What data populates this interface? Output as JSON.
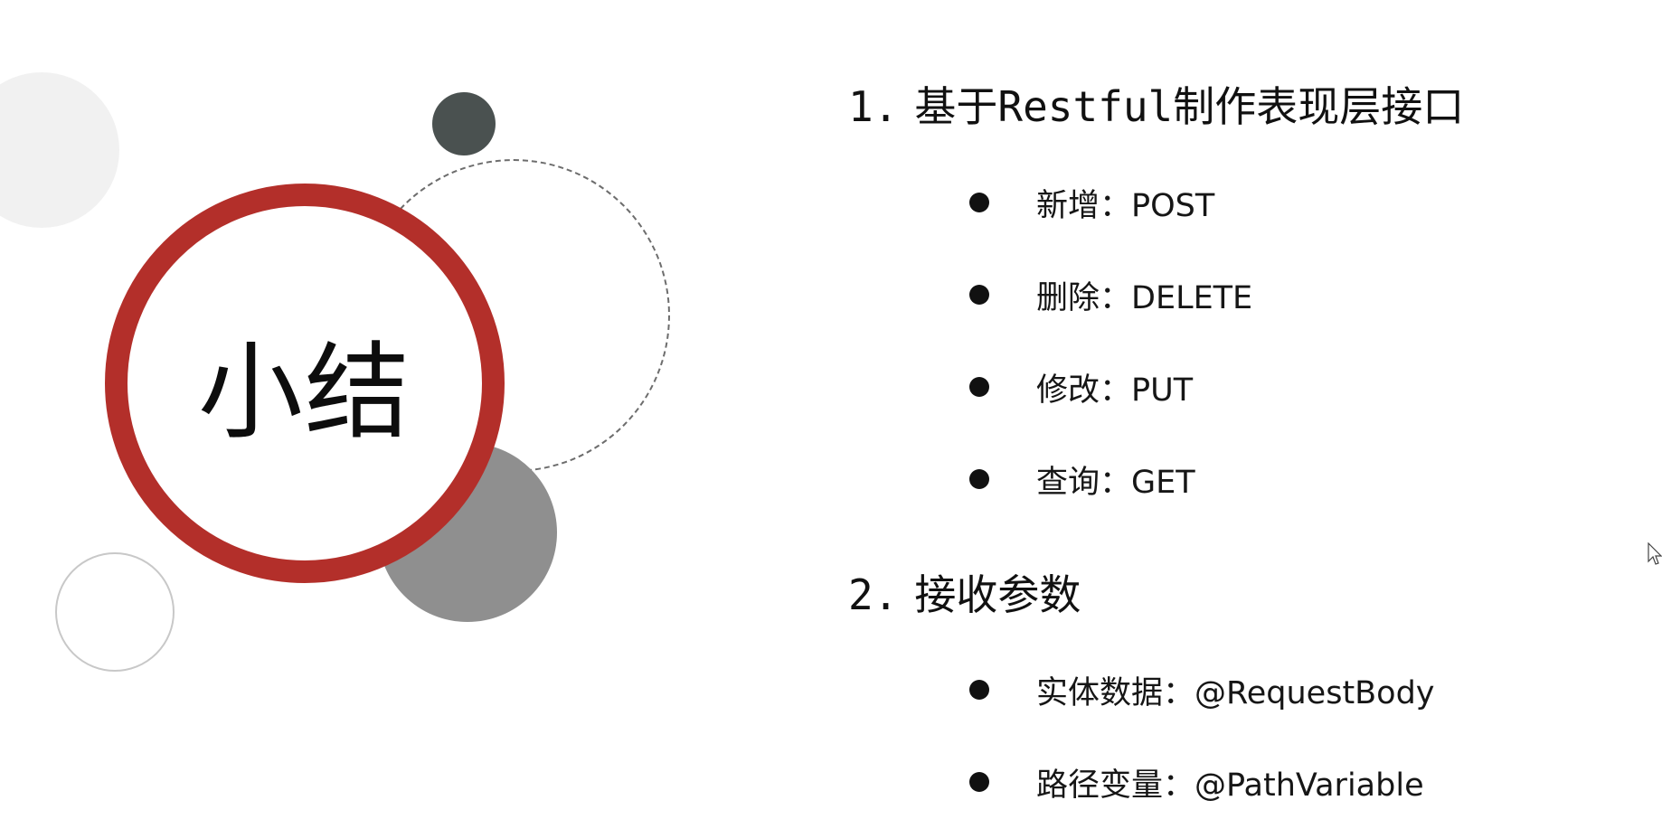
{
  "slide": {
    "title": "小结"
  },
  "sections": [
    {
      "number": "1.",
      "heading": "基于Restful制作表现层接口",
      "items": [
        {
          "label": "新增：POST"
        },
        {
          "label": "删除：DELETE"
        },
        {
          "label": "修改：PUT"
        },
        {
          "label": "查询：GET"
        }
      ]
    },
    {
      "number": "2.",
      "heading": "接收参数",
      "items": [
        {
          "label": "实体数据：@RequestBody"
        },
        {
          "label": "路径变量：@PathVariable"
        }
      ]
    }
  ],
  "colors": {
    "accent_red": "#b32f2a",
    "dark_circle": "#4a5150",
    "gray_circle": "#8f8f8f",
    "text": "#111111"
  },
  "icons": [
    "bullet-dot-icon",
    "mouse-cursor-icon"
  ]
}
